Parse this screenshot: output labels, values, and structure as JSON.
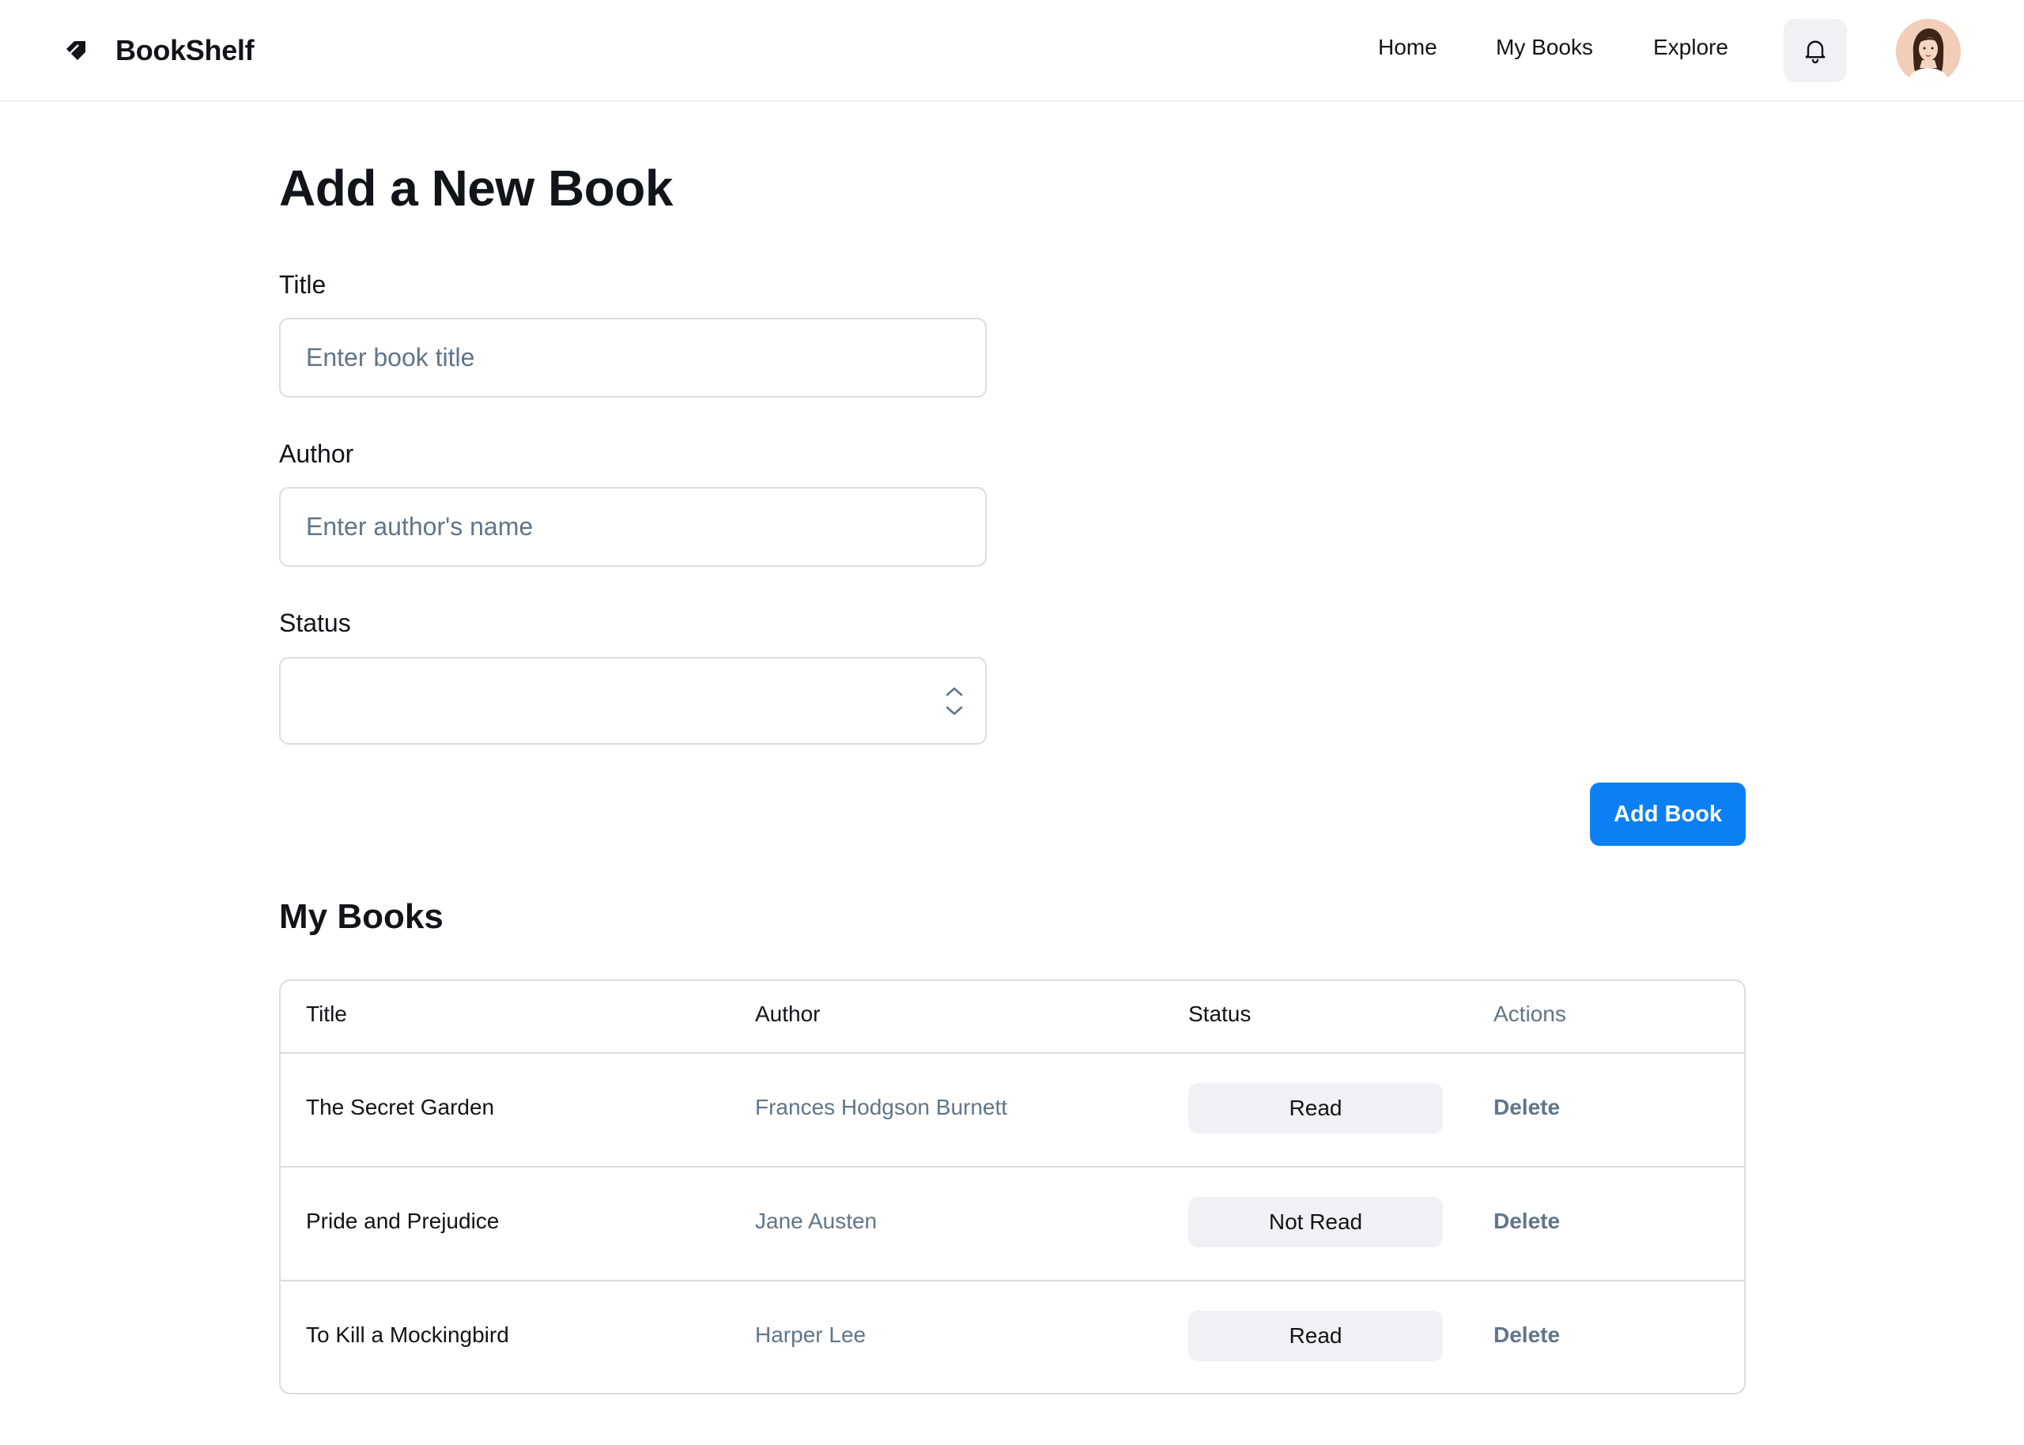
{
  "header": {
    "brand": "BookShelf",
    "nav": [
      {
        "label": "Home"
      },
      {
        "label": "My Books"
      },
      {
        "label": "Explore"
      }
    ],
    "icons": {
      "logo": "book-tag-icon",
      "notifications": "bell-icon",
      "profile": "user-avatar"
    }
  },
  "form": {
    "title": "Add a New Book",
    "fields": {
      "title": {
        "label": "Title",
        "placeholder": "Enter book title",
        "value": ""
      },
      "author": {
        "label": "Author",
        "placeholder": "Enter author's name",
        "value": ""
      },
      "status": {
        "label": "Status",
        "value": ""
      }
    },
    "submit_label": "Add Book"
  },
  "books": {
    "heading": "My Books",
    "columns": [
      "Title",
      "Author",
      "Status",
      "Actions"
    ],
    "rows": [
      {
        "title": "The Secret Garden",
        "author": "Frances Hodgson Burnett",
        "status": "Read",
        "action": "Delete"
      },
      {
        "title": "Pride and Prejudice",
        "author": "Jane Austen",
        "status": "Not Read",
        "action": "Delete"
      },
      {
        "title": "To Kill a Mockingbird",
        "author": "Harper Lee",
        "status": "Read",
        "action": "Delete"
      }
    ]
  },
  "colors": {
    "primary": "#0c7ff2",
    "text": "#111418",
    "muted": "#60758a",
    "border": "#d9dde3",
    "pill": "#eff1f4"
  }
}
